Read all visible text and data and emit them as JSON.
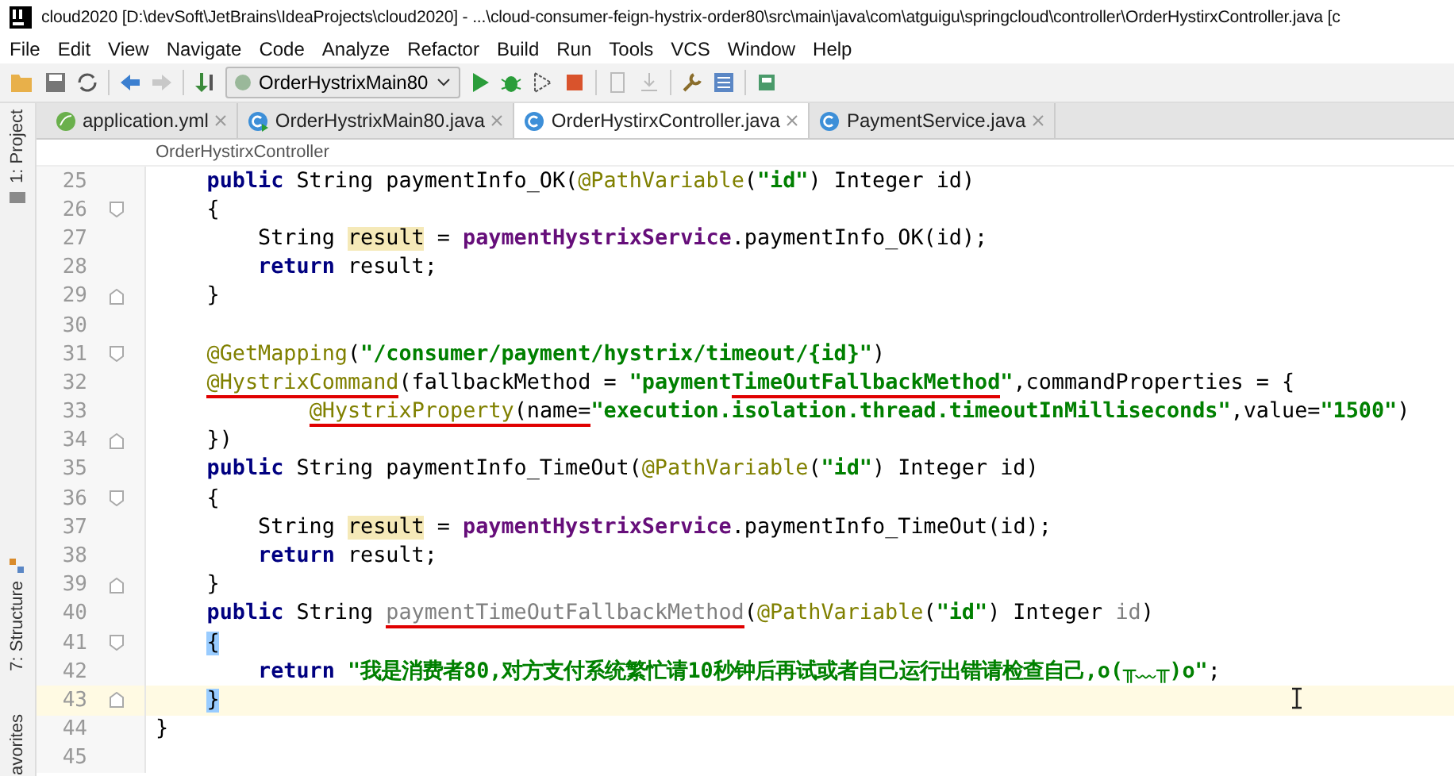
{
  "window": {
    "title": "cloud2020 [D:\\devSoft\\JetBrains\\IdeaProjects\\cloud2020] - ...\\cloud-consumer-feign-hystrix-order80\\src\\main\\java\\com\\atguigu\\springcloud\\controller\\OrderHystirxController.java [c"
  },
  "menu": [
    "File",
    "Edit",
    "View",
    "Navigate",
    "Code",
    "Analyze",
    "Refactor",
    "Build",
    "Run",
    "Tools",
    "VCS",
    "Window",
    "Help"
  ],
  "toolbar": {
    "run_config": "OrderHystrixMain80"
  },
  "tabs": [
    {
      "label": "application.yml",
      "kind": "yml",
      "selected": false
    },
    {
      "label": "OrderHystrixMain80.java",
      "kind": "main",
      "selected": false
    },
    {
      "label": "OrderHystirxController.java",
      "kind": "class",
      "selected": true
    },
    {
      "label": "PaymentService.java",
      "kind": "class",
      "selected": false
    }
  ],
  "breadcrumb": "OrderHystirxController",
  "side_tools": [
    {
      "label": "1: Project",
      "kind": "project"
    },
    {
      "label": "7: Structure",
      "kind": "structure"
    },
    {
      "label": "avorites",
      "kind": "favorites"
    }
  ],
  "editor": {
    "lines": [
      {
        "number": "25",
        "kind": "member",
        "fold_open": false,
        "fold_close": false,
        "current": false,
        "segments": [
          {
            "kind": "kw",
            "text": "public",
            "marked": false
          },
          {
            "kind": "text",
            "text": " String paymentInfo_OK(",
            "marked": false
          },
          {
            "kind": "ann",
            "text": "@PathVariable",
            "marked": false
          },
          {
            "kind": "text",
            "text": "(",
            "marked": false
          },
          {
            "kind": "str",
            "text": "\"id\"",
            "marked": false
          },
          {
            "kind": "text",
            "text": ") Integer id)",
            "marked": false
          }
        ]
      },
      {
        "number": "26",
        "kind": "member",
        "fold_open": true,
        "fold_close": false,
        "current": false,
        "segments": [
          {
            "kind": "text",
            "text": "{",
            "marked": false
          }
        ]
      },
      {
        "number": "27",
        "kind": "body",
        "fold_open": false,
        "fold_close": false,
        "current": false,
        "segments": [
          {
            "kind": "text",
            "text": "String ",
            "marked": false
          },
          {
            "kind": "var",
            "text": "result",
            "marked": false
          },
          {
            "kind": "text",
            "text": " = ",
            "marked": false
          },
          {
            "kind": "field",
            "text": "paymentHystrixService",
            "marked": false
          },
          {
            "kind": "text",
            "text": ".paymentInfo_OK(id);",
            "marked": false
          }
        ]
      },
      {
        "number": "28",
        "kind": "body",
        "fold_open": false,
        "fold_close": false,
        "current": false,
        "segments": [
          {
            "kind": "kw",
            "text": "return",
            "marked": false
          },
          {
            "kind": "text",
            "text": " result;",
            "marked": false
          }
        ]
      },
      {
        "number": "29",
        "kind": "member",
        "fold_open": false,
        "fold_close": true,
        "current": false,
        "segments": [
          {
            "kind": "text",
            "text": "}",
            "marked": false
          }
        ]
      },
      {
        "number": "30",
        "kind": "class",
        "fold_open": false,
        "fold_close": false,
        "current": false
      },
      {
        "number": "31",
        "kind": "member",
        "fold_open": true,
        "fold_close": false,
        "current": false,
        "segments": [
          {
            "kind": "ann",
            "text": "@GetMapping",
            "marked": false
          },
          {
            "kind": "text",
            "text": "(",
            "marked": false
          },
          {
            "kind": "str",
            "text": "\"/consumer/payment/hystrix/timeout/{id}\"",
            "marked": false
          },
          {
            "kind": "text",
            "text": ")",
            "marked": false
          }
        ]
      },
      {
        "number": "32",
        "kind": "member",
        "fold_open": false,
        "fold_close": false,
        "current": false,
        "segments": [
          {
            "kind": "ann",
            "text": "@HystrixCommand",
            "marked": true
          },
          {
            "kind": "text",
            "text": "(fallbackMethod = ",
            "marked": false
          },
          {
            "kind": "str",
            "text": "\"payment",
            "marked": false
          },
          {
            "kind": "str",
            "text": "TimeOutFallbackMethod",
            "marked": true
          },
          {
            "kind": "str",
            "text": "\"",
            "marked": false
          },
          {
            "kind": "text",
            "text": ",commandProperties = {",
            "marked": false
          }
        ]
      },
      {
        "number": "33",
        "kind": "nested",
        "fold_open": false,
        "fold_close": false,
        "current": false,
        "segments": [
          {
            "kind": "ann",
            "text": "@HystrixProperty",
            "marked": true
          },
          {
            "kind": "text",
            "text": "(name=",
            "marked": true
          },
          {
            "kind": "str",
            "text": "\"execution.isolation.thread.timeoutInMilliseconds\"",
            "marked": false
          },
          {
            "kind": "text",
            "text": ",value=",
            "marked": false
          },
          {
            "kind": "str",
            "text": "\"1500\"",
            "marked": false
          },
          {
            "kind": "text",
            "text": ")",
            "marked": false
          }
        ]
      },
      {
        "number": "34",
        "kind": "member",
        "fold_open": false,
        "fold_close": true,
        "current": false,
        "segments": [
          {
            "kind": "text",
            "text": "})",
            "marked": false
          }
        ]
      },
      {
        "number": "35",
        "kind": "member",
        "fold_open": false,
        "fold_close": false,
        "current": false,
        "segments": [
          {
            "kind": "kw",
            "text": "public",
            "marked": false
          },
          {
            "kind": "text",
            "text": " String paymentInfo_TimeOut(",
            "marked": false
          },
          {
            "kind": "ann",
            "text": "@PathVariable",
            "marked": false
          },
          {
            "kind": "text",
            "text": "(",
            "marked": false
          },
          {
            "kind": "str",
            "text": "\"id\"",
            "marked": false
          },
          {
            "kind": "text",
            "text": ") Integer id)",
            "marked": false
          }
        ]
      },
      {
        "number": "36",
        "kind": "member",
        "fold_open": true,
        "fold_close": false,
        "current": false,
        "segments": [
          {
            "kind": "text",
            "text": "{",
            "marked": false
          }
        ]
      },
      {
        "number": "37",
        "kind": "body",
        "fold_open": false,
        "fold_close": false,
        "current": false,
        "segments": [
          {
            "kind": "text",
            "text": "String ",
            "marked": false
          },
          {
            "kind": "var",
            "text": "result",
            "marked": false
          },
          {
            "kind": "text",
            "text": " = ",
            "marked": false
          },
          {
            "kind": "field",
            "text": "paymentHystrixService",
            "marked": false
          },
          {
            "kind": "text",
            "text": ".paymentInfo_TimeOut(id);",
            "marked": false
          }
        ]
      },
      {
        "number": "38",
        "kind": "body",
        "fold_open": false,
        "fold_close": false,
        "current": false,
        "segments": [
          {
            "kind": "kw",
            "text": "return",
            "marked": false
          },
          {
            "kind": "text",
            "text": " result;",
            "marked": false
          }
        ]
      },
      {
        "number": "39",
        "kind": "member",
        "fold_open": false,
        "fold_close": true,
        "current": false,
        "segments": [
          {
            "kind": "text",
            "text": "}",
            "marked": false
          }
        ]
      },
      {
        "number": "40",
        "kind": "member",
        "fold_open": false,
        "fold_close": false,
        "current": false,
        "segments": [
          {
            "kind": "kw",
            "text": "public",
            "marked": false
          },
          {
            "kind": "text",
            "text": " String ",
            "marked": false
          },
          {
            "kind": "unused",
            "text": "paymentTimeOutFallbackMethod",
            "marked": true
          },
          {
            "kind": "text",
            "text": "(",
            "marked": false
          },
          {
            "kind": "ann",
            "text": "@PathVariable",
            "marked": false
          },
          {
            "kind": "text",
            "text": "(",
            "marked": false
          },
          {
            "kind": "str",
            "text": "\"id\"",
            "marked": false
          },
          {
            "kind": "text",
            "text": ") Integer ",
            "marked": false
          },
          {
            "kind": "unused",
            "text": "id",
            "marked": false
          },
          {
            "kind": "text",
            "text": ")",
            "marked": false
          }
        ]
      },
      {
        "number": "41",
        "kind": "member",
        "fold_open": true,
        "fold_close": false,
        "current": false,
        "segments": [
          {
            "kind": "brace",
            "text": "{",
            "marked": false
          }
        ]
      },
      {
        "number": "42",
        "kind": "body",
        "fold_open": false,
        "fold_close": false,
        "current": false,
        "segments": [
          {
            "kind": "kw",
            "text": "return ",
            "marked": false
          },
          {
            "kind": "str",
            "text": "\"我是消费者80,对方支付系统繁忙请10秒钟后再试或者自己运行出错请检查自己,o(╥﹏╥)o\"",
            "marked": false
          },
          {
            "kind": "text",
            "text": ";",
            "marked": false
          }
        ]
      },
      {
        "number": "43",
        "kind": "member",
        "fold_open": false,
        "fold_close": true,
        "current": true,
        "segments": [
          {
            "kind": "brace",
            "text": "}",
            "marked": false
          }
        ]
      },
      {
        "number": "44",
        "kind": "class",
        "fold_open": false,
        "fold_close": false,
        "current": false,
        "segments": [
          {
            "kind": "text",
            "text": "}",
            "marked": false
          }
        ]
      },
      {
        "number": "45",
        "kind": "class",
        "fold_open": false,
        "fold_close": false,
        "current": false
      }
    ]
  }
}
